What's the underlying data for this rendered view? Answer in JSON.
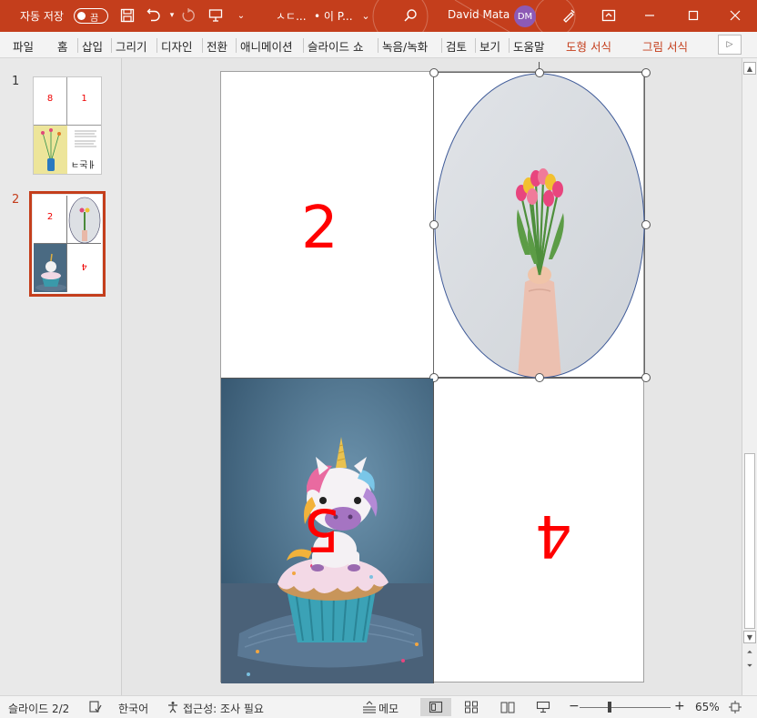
{
  "titlebar": {
    "autosave_label": "자동 저장",
    "autosave_state": "끔",
    "doc_title": "ㅅㄷ...",
    "location": "• 이 P...",
    "user_name": "David Mata",
    "user_initials": "DM",
    "accent": "#c43e1c"
  },
  "ribbon": {
    "tabs": [
      "파일",
      "홈",
      "삽입",
      "그리기",
      "디자인",
      "전환",
      "애니메이션",
      "슬라이드 쇼",
      "녹음/녹화",
      "검토",
      "보기",
      "도움말"
    ],
    "context_tabs": [
      "도형 서식",
      "그림 서식"
    ]
  },
  "thumbnails": [
    {
      "number": "1",
      "q1": "8",
      "q2": "1",
      "q4_text": "ㅔ논ㅋ"
    },
    {
      "number": "2",
      "q1": "2",
      "q4": "4"
    }
  ],
  "slide": {
    "num_top_left": "2",
    "num_bottom_left": "5",
    "num_bottom_right": "4",
    "number_color": "#ff0000"
  },
  "statusbar": {
    "slide_info": "슬라이드 2/2",
    "language": "한국어",
    "accessibility": "접근성: 조사 필요",
    "notes": "메모",
    "zoom": "65%"
  }
}
